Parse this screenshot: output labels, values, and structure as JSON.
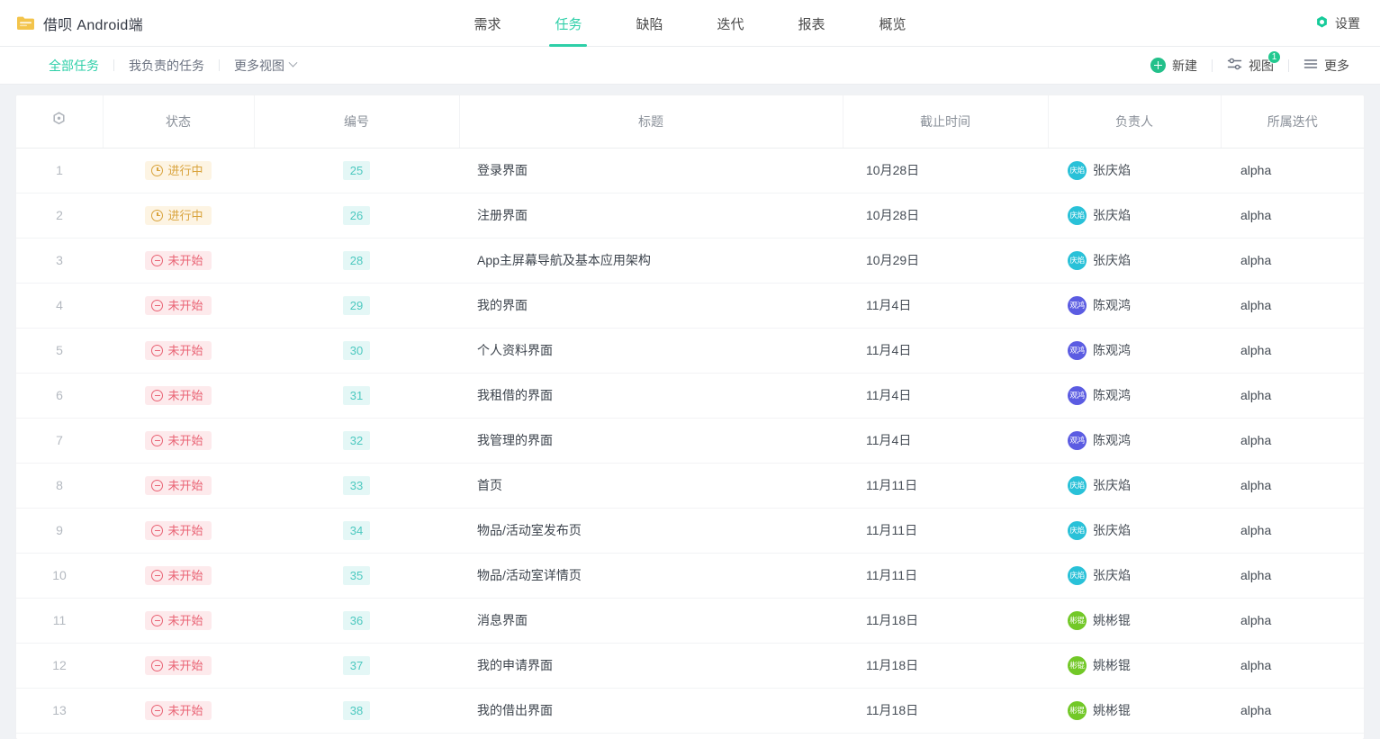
{
  "header": {
    "project_title": "借呗 Android端",
    "project_icon": "folder-icon",
    "nav": [
      {
        "label": "需求",
        "active": false
      },
      {
        "label": "任务",
        "active": true
      },
      {
        "label": "缺陷",
        "active": false
      },
      {
        "label": "迭代",
        "active": false
      },
      {
        "label": "报表",
        "active": false
      },
      {
        "label": "概览",
        "active": false
      }
    ],
    "settings_label": "设置"
  },
  "subbar": {
    "views": [
      {
        "label": "全部任务",
        "active": true
      },
      {
        "label": "我负责的任务",
        "active": false
      },
      {
        "label": "更多视图",
        "active": false,
        "chevron": true
      }
    ],
    "tools": {
      "new_label": "新建",
      "view_label": "视图",
      "view_badge": "1",
      "more_label": "更多"
    }
  },
  "table": {
    "columns": [
      {
        "key": "idx",
        "label": ""
      },
      {
        "key": "state",
        "label": "状态"
      },
      {
        "key": "id",
        "label": "编号"
      },
      {
        "key": "title",
        "label": "标题"
      },
      {
        "key": "due",
        "label": "截止时间"
      },
      {
        "key": "owner",
        "label": "负责人"
      },
      {
        "key": "iteration",
        "label": "所属迭代"
      }
    ],
    "rows": [
      {
        "idx": "1",
        "state": "进行中",
        "state_type": "doing",
        "id": "25",
        "title": "登录界面",
        "due": "10月28日",
        "owner": "张庆焰",
        "avatar": "庆焰",
        "avatar_color": "#29c1d8",
        "iteration": "alpha"
      },
      {
        "idx": "2",
        "state": "进行中",
        "state_type": "doing",
        "id": "26",
        "title": "注册界面",
        "due": "10月28日",
        "owner": "张庆焰",
        "avatar": "庆焰",
        "avatar_color": "#29c1d8",
        "iteration": "alpha"
      },
      {
        "idx": "3",
        "state": "未开始",
        "state_type": "todo",
        "id": "28",
        "title": "App主屏幕导航及基本应用架构",
        "due": "10月29日",
        "owner": "张庆焰",
        "avatar": "庆焰",
        "avatar_color": "#29c1d8",
        "iteration": "alpha"
      },
      {
        "idx": "4",
        "state": "未开始",
        "state_type": "todo",
        "id": "29",
        "title": "我的界面",
        "due": "11月4日",
        "owner": "陈观鸿",
        "avatar": "观鸿",
        "avatar_color": "#5b5ce2",
        "iteration": "alpha"
      },
      {
        "idx": "5",
        "state": "未开始",
        "state_type": "todo",
        "id": "30",
        "title": "个人资料界面",
        "due": "11月4日",
        "owner": "陈观鸿",
        "avatar": "观鸿",
        "avatar_color": "#5b5ce2",
        "iteration": "alpha"
      },
      {
        "idx": "6",
        "state": "未开始",
        "state_type": "todo",
        "id": "31",
        "title": "我租借的界面",
        "due": "11月4日",
        "owner": "陈观鸿",
        "avatar": "观鸿",
        "avatar_color": "#5b5ce2",
        "iteration": "alpha"
      },
      {
        "idx": "7",
        "state": "未开始",
        "state_type": "todo",
        "id": "32",
        "title": "我管理的界面",
        "due": "11月4日",
        "owner": "陈观鸿",
        "avatar": "观鸿",
        "avatar_color": "#5b5ce2",
        "iteration": "alpha"
      },
      {
        "idx": "8",
        "state": "未开始",
        "state_type": "todo",
        "id": "33",
        "title": "首页",
        "due": "11月11日",
        "owner": "张庆焰",
        "avatar": "庆焰",
        "avatar_color": "#29c1d8",
        "iteration": "alpha"
      },
      {
        "idx": "9",
        "state": "未开始",
        "state_type": "todo",
        "id": "34",
        "title": "物品/活动室发布页",
        "due": "11月11日",
        "owner": "张庆焰",
        "avatar": "庆焰",
        "avatar_color": "#29c1d8",
        "iteration": "alpha"
      },
      {
        "idx": "10",
        "state": "未开始",
        "state_type": "todo",
        "id": "35",
        "title": "物品/活动室详情页",
        "due": "11月11日",
        "owner": "张庆焰",
        "avatar": "庆焰",
        "avatar_color": "#29c1d8",
        "iteration": "alpha"
      },
      {
        "idx": "11",
        "state": "未开始",
        "state_type": "todo",
        "id": "36",
        "title": "消息界面",
        "due": "11月18日",
        "owner": "姚彬锟",
        "avatar": "彬锟",
        "avatar_color": "#72c827",
        "iteration": "alpha"
      },
      {
        "idx": "12",
        "state": "未开始",
        "state_type": "todo",
        "id": "37",
        "title": "我的申请界面",
        "due": "11月18日",
        "owner": "姚彬锟",
        "avatar": "彬锟",
        "avatar_color": "#72c827",
        "iteration": "alpha"
      },
      {
        "idx": "13",
        "state": "未开始",
        "state_type": "todo",
        "id": "38",
        "title": "我的借出界面",
        "due": "11月18日",
        "owner": "姚彬锟",
        "avatar": "彬锟",
        "avatar_color": "#72c827",
        "iteration": "alpha"
      }
    ]
  },
  "colors": {
    "accent": "#2ecfa8",
    "status_doing_bg": "#fdf4e3",
    "status_doing_fg": "#d9a33c",
    "status_todo_bg": "#fdeaec",
    "status_todo_fg": "#e96374",
    "id_chip_bg": "#e4f7f6",
    "id_chip_fg": "#4dc9c0"
  }
}
